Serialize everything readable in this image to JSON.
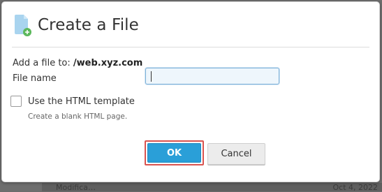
{
  "background": {
    "left_text": "Modifica…",
    "right_text": "Oct 4, 2022"
  },
  "dialog": {
    "title": "Create a File",
    "icon": "new-file-icon",
    "target_prefix": "Add a file to:",
    "target_path": "/web.xyz.com",
    "filename_label": "File name",
    "filename_value": "",
    "template_checkbox_label": "Use the HTML template",
    "template_checked": false,
    "template_hint": "Create a blank HTML page.",
    "ok_label": "OK",
    "cancel_label": "Cancel"
  },
  "colors": {
    "accent": "#2a9fd8",
    "highlight": "#d9534f",
    "icon_doc": "#a9d4ef",
    "icon_plus": "#5cb85c"
  }
}
